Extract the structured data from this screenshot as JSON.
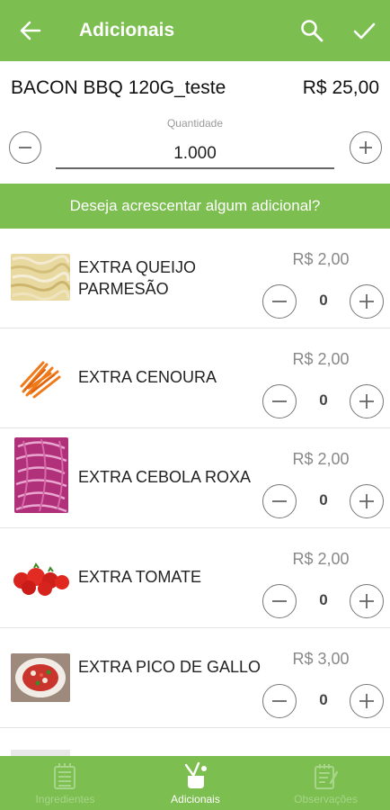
{
  "appbar": {
    "title": "Adicionais",
    "back_icon": "arrow-left-icon",
    "search_icon": "search-icon",
    "confirm_icon": "check-icon"
  },
  "product": {
    "name": "BACON BBQ 120G_teste",
    "price": "R$ 25,00",
    "quantity_label": "Quantidade",
    "quantity": "1.000"
  },
  "banner": {
    "text": "Deseja acrescentar algum adicional?"
  },
  "items": [
    {
      "name": "EXTRA QUEIJO PARMESÃO",
      "price": "R$ 2,00",
      "count": "0",
      "image": "parmesan-image"
    },
    {
      "name": "EXTRA CENOURA",
      "price": "R$ 2,00",
      "count": "0",
      "image": "carrot-image"
    },
    {
      "name": "EXTRA CEBOLA ROXA",
      "price": "R$ 2,00",
      "count": "0",
      "image": "red-onion-image"
    },
    {
      "name": "EXTRA TOMATE",
      "price": "R$ 2,00",
      "count": "0",
      "image": "tomato-image"
    },
    {
      "name": "EXTRA PICO DE GALLO",
      "price": "R$ 3,00",
      "count": "0",
      "image": "pico-de-gallo-image"
    }
  ],
  "bottom_nav": [
    {
      "label": "Ingredientes",
      "icon": "menu-list-icon",
      "active": false
    },
    {
      "label": "Adicionais",
      "icon": "cooking-pot-icon",
      "active": true
    },
    {
      "label": "Observações",
      "icon": "notepad-icon",
      "active": false
    }
  ],
  "colors": {
    "brand_green": "#7cbe4f",
    "inactive_nav_text": "#a7d58a"
  }
}
